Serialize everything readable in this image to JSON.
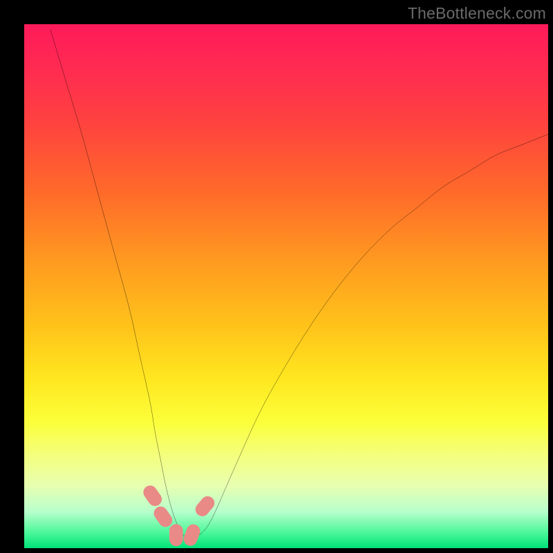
{
  "watermark": "TheBottleneck.com",
  "chart_data": {
    "type": "line",
    "title": "",
    "xlabel": "",
    "ylabel": "",
    "xlim": [
      0,
      100
    ],
    "ylim": [
      0,
      100
    ],
    "grid": false,
    "legend": "none",
    "series": [
      {
        "name": "bottleneck-curve",
        "x": [
          5,
          8,
          11,
          14,
          17,
          20,
          22,
          24,
          25,
          26,
          27,
          28,
          29,
          30,
          31,
          32,
          34,
          36,
          40,
          45,
          50,
          55,
          60,
          65,
          70,
          75,
          80,
          85,
          90,
          95,
          100
        ],
        "values": [
          99,
          89,
          79,
          68,
          57,
          46,
          37,
          28,
          22,
          17,
          12,
          8,
          5,
          3,
          2,
          2,
          3,
          6,
          15,
          26,
          35,
          43,
          50,
          56,
          61,
          65,
          69,
          72,
          75,
          77,
          79
        ]
      }
    ],
    "annotations": {
      "dip_markers": [
        {
          "x": 24.5,
          "y": 10
        },
        {
          "x": 26.5,
          "y": 6
        },
        {
          "x": 29.0,
          "y": 2.5
        },
        {
          "x": 32.0,
          "y": 2.5
        },
        {
          "x": 34.5,
          "y": 8
        }
      ]
    }
  }
}
